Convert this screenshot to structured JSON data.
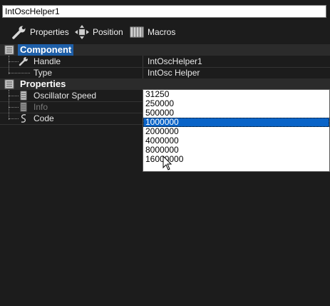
{
  "component_name": "IntOscHelper1",
  "toolbar": {
    "properties_label": "Properties",
    "position_label": "Position",
    "macros_label": "Macros"
  },
  "sections": {
    "component": {
      "label": "Component",
      "rows": [
        {
          "name": "Handle",
          "value": "IntOscHelper1",
          "icon": "wrench-icon"
        },
        {
          "name": "Type",
          "value": "IntOsc Helper",
          "icon": ""
        }
      ]
    },
    "properties": {
      "label": "Properties",
      "rows": [
        {
          "name": "Oscillator Speed",
          "icon": "list-icon"
        },
        {
          "name": "Info",
          "icon": "list-icon"
        },
        {
          "name": "Code",
          "icon": "code-icon"
        }
      ]
    }
  },
  "oscillator_speed_dropdown": {
    "options": [
      "31250",
      "250000",
      "500000",
      "1000000",
      "2000000",
      "4000000",
      "8000000",
      "16000000"
    ],
    "selected": "1000000"
  },
  "colors": {
    "background": "#1c1c1c",
    "section_background": "#2b2b2b",
    "selection_blue": "#0a64c8",
    "section_highlight": "#1e5fa8"
  }
}
